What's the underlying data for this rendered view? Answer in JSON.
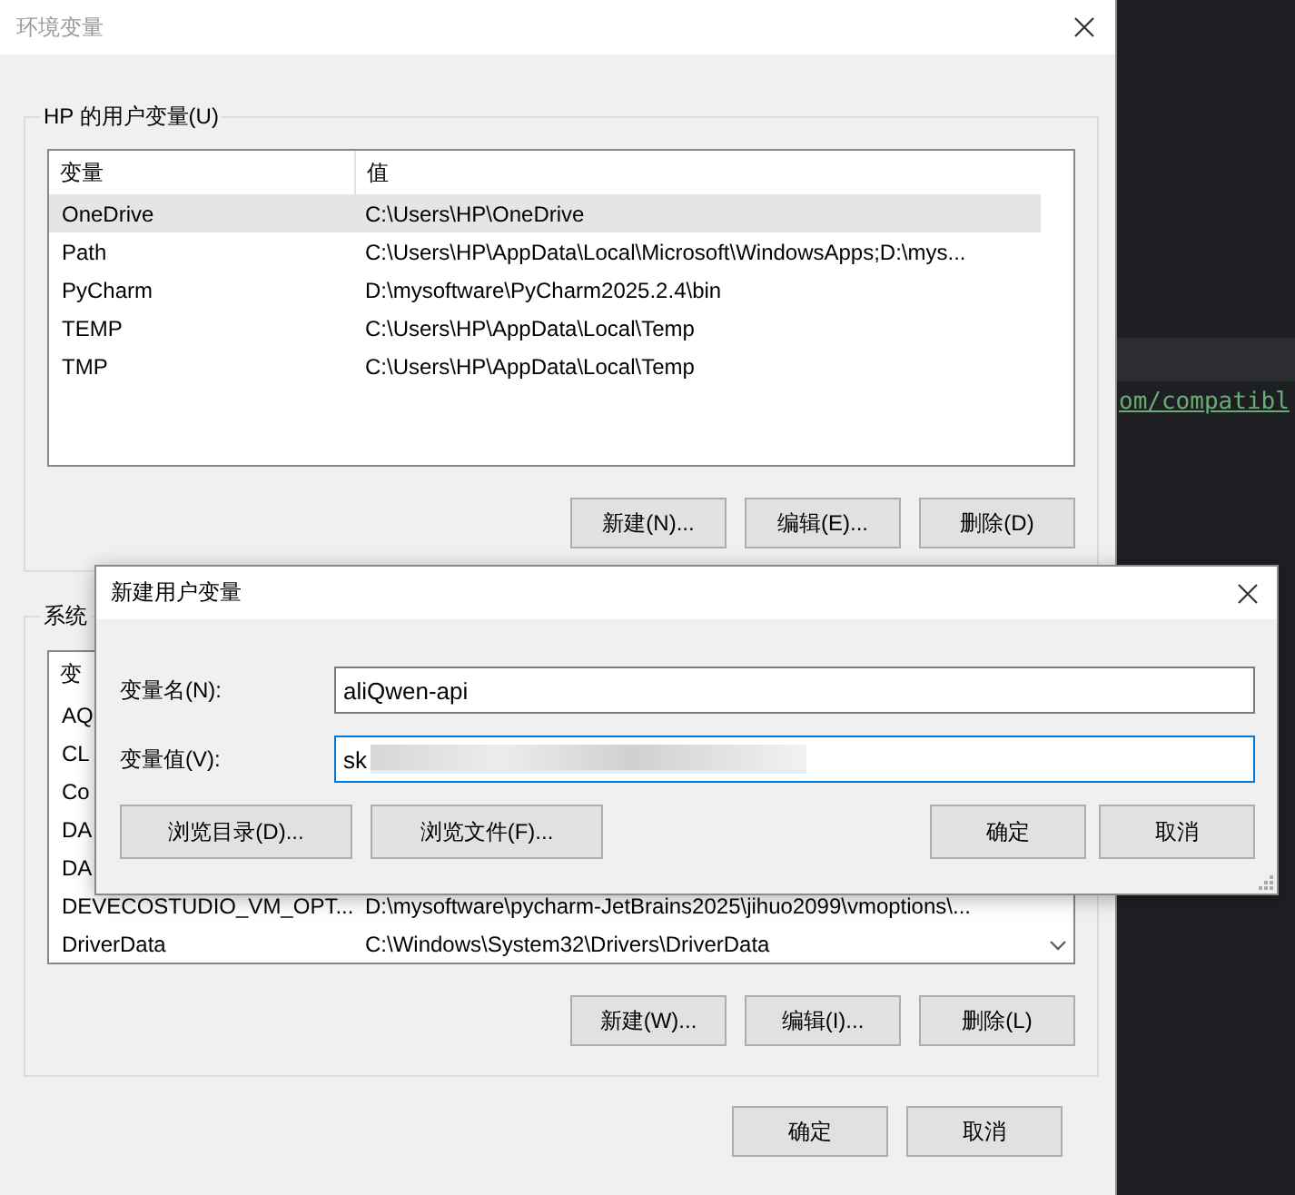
{
  "window": {
    "title": "环境变量"
  },
  "user_variables": {
    "label": "HP 的用户变量(U)",
    "columns": [
      "变量",
      "值"
    ],
    "rows": [
      {
        "name": "OneDrive",
        "value": "C:\\Users\\HP\\OneDrive",
        "selected": true
      },
      {
        "name": "Path",
        "value": "C:\\Users\\HP\\AppData\\Local\\Microsoft\\WindowsApps;D:\\mys...",
        "selected": false
      },
      {
        "name": "PyCharm",
        "value": "D:\\mysoftware\\PyCharm2025.2.4\\bin",
        "selected": false
      },
      {
        "name": "TEMP",
        "value": "C:\\Users\\HP\\AppData\\Local\\Temp",
        "selected": false
      },
      {
        "name": "TMP",
        "value": "C:\\Users\\HP\\AppData\\Local\\Temp",
        "selected": false
      }
    ],
    "buttons": [
      "新建(N)...",
      "编辑(E)...",
      "删除(D)"
    ]
  },
  "system_variables": {
    "label": "系统",
    "columns": [
      "变"
    ],
    "rows": [
      {
        "name": "AQ"
      },
      {
        "name": "CL"
      },
      {
        "name": "Co"
      },
      {
        "name": "DA"
      },
      {
        "name": "DA"
      },
      {
        "name": "DEVECOSTUDIO_VM_OPT...",
        "value": "D:\\mysoftware\\pycharm-JetBrains2025\\jihuo2099\\vmoptions\\..."
      },
      {
        "name": "DriverData",
        "value": "C:\\Windows\\System32\\Drivers\\DriverData"
      }
    ],
    "buttons": [
      "新建(W)...",
      "编辑(I)...",
      "删除(L)"
    ]
  },
  "buttons": [
    "确定",
    "取消"
  ],
  "editor_fragment": "om/compatibl",
  "dialog": {
    "title": "新建用户变量",
    "fields": [
      {
        "label": "变量名(N):",
        "value": "aliQwen-api",
        "focused": false
      },
      {
        "label": "变量值(V):",
        "value": "sk",
        "focused": true
      }
    ],
    "left_buttons": [
      "浏览目录(D)...",
      "浏览文件(F)..."
    ],
    "buttons": [
      "确定",
      "取消"
    ]
  }
}
